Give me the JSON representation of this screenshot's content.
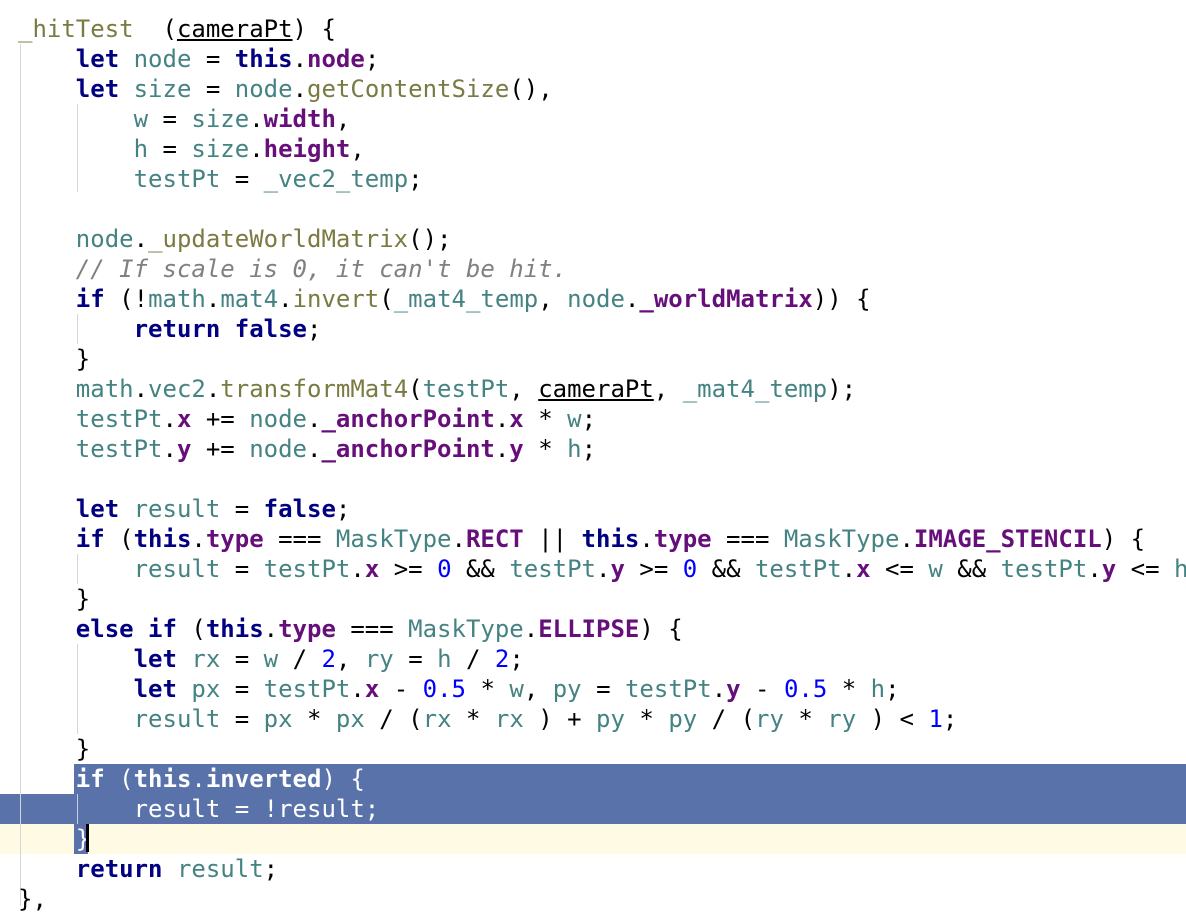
{
  "editor": {
    "selection_color": "#5a72aa",
    "current_line_color": "#fffae3",
    "lines": [
      [
        [
          "fn",
          "_hitTest"
        ],
        [
          "",
          "  ("
        ],
        [
          "param",
          "cameraPt"
        ],
        [
          "",
          ") {"
        ]
      ],
      [
        [
          "",
          "    "
        ],
        [
          "kw",
          "let"
        ],
        [
          "",
          "",
          " "
        ],
        [
          "id",
          "node"
        ],
        [
          "",
          " = "
        ],
        [
          "kw",
          "this"
        ],
        [
          "",
          "."
        ],
        [
          "prop",
          "node"
        ],
        [
          "",
          ";"
        ]
      ],
      [
        [
          "",
          "    "
        ],
        [
          "kw",
          "let"
        ],
        [
          "",
          "",
          " "
        ],
        [
          "id",
          "size"
        ],
        [
          "",
          " = "
        ],
        [
          "id",
          "node"
        ],
        [
          "",
          "."
        ],
        [
          "fn",
          "getContentSize"
        ],
        [
          "",
          "(),"
        ]
      ],
      [
        [
          "",
          "        "
        ],
        [
          "id",
          "w"
        ],
        [
          "",
          " = "
        ],
        [
          "id",
          "size"
        ],
        [
          "",
          "."
        ],
        [
          "prop",
          "width"
        ],
        [
          "",
          ","
        ]
      ],
      [
        [
          "",
          "        "
        ],
        [
          "id",
          "h"
        ],
        [
          "",
          " = "
        ],
        [
          "id",
          "size"
        ],
        [
          "",
          "."
        ],
        [
          "prop",
          "height"
        ],
        [
          "",
          ","
        ]
      ],
      [
        [
          "",
          "        "
        ],
        [
          "id",
          "testPt"
        ],
        [
          "",
          " = "
        ],
        [
          "id",
          "_vec2_temp"
        ],
        [
          "",
          ";"
        ]
      ],
      [
        [
          "",
          ""
        ]
      ],
      [
        [
          "",
          "    "
        ],
        [
          "id",
          "node"
        ],
        [
          "",
          "."
        ],
        [
          "fn",
          "_updateWorldMatrix"
        ],
        [
          "",
          "();"
        ]
      ],
      [
        [
          "",
          "    "
        ],
        [
          "cm",
          "// If scale is 0, it can't be hit."
        ]
      ],
      [
        [
          "",
          "    "
        ],
        [
          "kw",
          "if"
        ],
        [
          "",
          " (!"
        ],
        [
          "id",
          "math"
        ],
        [
          "",
          "."
        ],
        [
          "id",
          "mat4"
        ],
        [
          "",
          "."
        ],
        [
          "fn",
          "invert"
        ],
        [
          "",
          "("
        ],
        [
          "id",
          "_mat4_temp"
        ],
        [
          "",
          ", "
        ],
        [
          "id",
          "node"
        ],
        [
          "",
          "."
        ],
        [
          "prop",
          "_worldMatrix"
        ],
        [
          "",
          ")) {"
        ]
      ],
      [
        [
          "",
          "        "
        ],
        [
          "kw",
          "return false"
        ],
        [
          "",
          ";"
        ]
      ],
      [
        [
          "",
          "    }"
        ]
      ],
      [
        [
          "",
          "    "
        ],
        [
          "id",
          "math"
        ],
        [
          "",
          "."
        ],
        [
          "id",
          "vec2"
        ],
        [
          "",
          "."
        ],
        [
          "fn",
          "transformMat4"
        ],
        [
          "",
          "("
        ],
        [
          "id",
          "testPt"
        ],
        [
          "",
          ", "
        ],
        [
          "param",
          "cameraPt"
        ],
        [
          "",
          ", "
        ],
        [
          "id",
          "_mat4_temp"
        ],
        [
          "",
          ");"
        ]
      ],
      [
        [
          "",
          "    "
        ],
        [
          "id",
          "testPt"
        ],
        [
          "",
          "."
        ],
        [
          "prop",
          "x"
        ],
        [
          "",
          " += "
        ],
        [
          "id",
          "node"
        ],
        [
          "",
          "."
        ],
        [
          "prop",
          "_anchorPoint"
        ],
        [
          "",
          "."
        ],
        [
          "prop",
          "x"
        ],
        [
          "",
          " * "
        ],
        [
          "id",
          "w"
        ],
        [
          "",
          ";"
        ]
      ],
      [
        [
          "",
          "    "
        ],
        [
          "id",
          "testPt"
        ],
        [
          "",
          "."
        ],
        [
          "prop",
          "y"
        ],
        [
          "",
          " += "
        ],
        [
          "id",
          "node"
        ],
        [
          "",
          "."
        ],
        [
          "prop",
          "_anchorPoint"
        ],
        [
          "",
          "."
        ],
        [
          "prop",
          "y"
        ],
        [
          "",
          " * "
        ],
        [
          "id",
          "h"
        ],
        [
          "",
          ";"
        ]
      ],
      [
        [
          "",
          ""
        ]
      ],
      [
        [
          "",
          "    "
        ],
        [
          "kw",
          "let"
        ],
        [
          "",
          " "
        ],
        [
          "id",
          "result"
        ],
        [
          "",
          " = "
        ],
        [
          "kw",
          "false"
        ],
        [
          "",
          ";"
        ]
      ],
      [
        [
          "",
          "    "
        ],
        [
          "kw",
          "if"
        ],
        [
          "",
          " ("
        ],
        [
          "kw",
          "this"
        ],
        [
          "",
          "."
        ],
        [
          "prop",
          "type"
        ],
        [
          "",
          " === "
        ],
        [
          "id",
          "MaskType"
        ],
        [
          "",
          "."
        ],
        [
          "prop",
          "RECT"
        ],
        [
          "",
          " || "
        ],
        [
          "kw",
          "this"
        ],
        [
          "",
          "."
        ],
        [
          "prop",
          "type"
        ],
        [
          "",
          " === "
        ],
        [
          "id",
          "MaskType"
        ],
        [
          "",
          "."
        ],
        [
          "prop",
          "IMAGE_STENCIL"
        ],
        [
          "",
          ") {"
        ]
      ],
      [
        [
          "",
          "        "
        ],
        [
          "id",
          "result"
        ],
        [
          "",
          " = "
        ],
        [
          "id",
          "testPt"
        ],
        [
          "",
          "."
        ],
        [
          "prop",
          "x"
        ],
        [
          "",
          " >= "
        ],
        [
          "num",
          "0"
        ],
        [
          "",
          " && "
        ],
        [
          "id",
          "testPt"
        ],
        [
          "",
          "."
        ],
        [
          "prop",
          "y"
        ],
        [
          "",
          " >= "
        ],
        [
          "num",
          "0"
        ],
        [
          "",
          " && "
        ],
        [
          "id",
          "testPt"
        ],
        [
          "",
          "."
        ],
        [
          "prop",
          "x"
        ],
        [
          "",
          " <= "
        ],
        [
          "id",
          "w"
        ],
        [
          "",
          " && "
        ],
        [
          "id",
          "testPt"
        ],
        [
          "",
          "."
        ],
        [
          "prop",
          "y"
        ],
        [
          "",
          " <= "
        ],
        [
          "id",
          "h"
        ],
        [
          "",
          ";"
        ]
      ],
      [
        [
          "",
          "    }"
        ]
      ],
      [
        [
          "",
          "    "
        ],
        [
          "kw",
          "else if"
        ],
        [
          "",
          " ("
        ],
        [
          "kw",
          "this"
        ],
        [
          "",
          "."
        ],
        [
          "prop",
          "type"
        ],
        [
          "",
          " === "
        ],
        [
          "id",
          "MaskType"
        ],
        [
          "",
          "."
        ],
        [
          "prop",
          "ELLIPSE"
        ],
        [
          "",
          ") {"
        ]
      ],
      [
        [
          "",
          "        "
        ],
        [
          "kw",
          "let"
        ],
        [
          "",
          " "
        ],
        [
          "id",
          "rx"
        ],
        [
          "",
          " = "
        ],
        [
          "id",
          "w"
        ],
        [
          "",
          " / "
        ],
        [
          "num",
          "2"
        ],
        [
          "",
          ", "
        ],
        [
          "id",
          "ry"
        ],
        [
          "",
          " = "
        ],
        [
          "id",
          "h"
        ],
        [
          "",
          " / "
        ],
        [
          "num",
          "2"
        ],
        [
          "",
          ";"
        ]
      ],
      [
        [
          "",
          "        "
        ],
        [
          "kw",
          "let"
        ],
        [
          "",
          " "
        ],
        [
          "id",
          "px"
        ],
        [
          "",
          " = "
        ],
        [
          "id",
          "testPt"
        ],
        [
          "",
          "."
        ],
        [
          "prop",
          "x"
        ],
        [
          "",
          " - "
        ],
        [
          "num",
          "0.5"
        ],
        [
          "",
          " * "
        ],
        [
          "id",
          "w"
        ],
        [
          "",
          ", "
        ],
        [
          "id",
          "py"
        ],
        [
          "",
          " = "
        ],
        [
          "id",
          "testPt"
        ],
        [
          "",
          "."
        ],
        [
          "prop",
          "y"
        ],
        [
          "",
          " - "
        ],
        [
          "num",
          "0.5"
        ],
        [
          "",
          " * "
        ],
        [
          "id",
          "h"
        ],
        [
          "",
          ";"
        ]
      ],
      [
        [
          "",
          "        "
        ],
        [
          "id",
          "result"
        ],
        [
          "",
          " = "
        ],
        [
          "id",
          "px"
        ],
        [
          "",
          " * "
        ],
        [
          "id",
          "px"
        ],
        [
          "",
          " / ("
        ],
        [
          "id",
          "rx"
        ],
        [
          "",
          " * "
        ],
        [
          "id",
          "rx"
        ],
        [
          "",
          " ) + "
        ],
        [
          "id",
          "py"
        ],
        [
          "",
          " * "
        ],
        [
          "id",
          "py"
        ],
        [
          "",
          " / ("
        ],
        [
          "id",
          "ry"
        ],
        [
          "",
          " * "
        ],
        [
          "id",
          "ry"
        ],
        [
          "",
          " ) < "
        ],
        [
          "num",
          "1"
        ],
        [
          "",
          ";"
        ]
      ],
      [
        [
          "",
          "    }"
        ]
      ],
      [
        [
          "",
          "    "
        ],
        [
          "kw",
          "if"
        ],
        [
          "",
          " ("
        ],
        [
          "kw",
          "this"
        ],
        [
          "",
          "."
        ],
        [
          "prop",
          "inverted"
        ],
        [
          "",
          ") {"
        ]
      ],
      [
        [
          "",
          "        "
        ],
        [
          "id",
          "result"
        ],
        [
          "",
          " = !"
        ],
        [
          "id",
          "result"
        ],
        [
          "",
          ";"
        ]
      ],
      [
        [
          "",
          "    }"
        ]
      ],
      [
        [
          "",
          "    "
        ],
        [
          "kw",
          "return"
        ],
        [
          "",
          " "
        ],
        [
          "id",
          "result"
        ],
        [
          "",
          ";"
        ]
      ],
      [
        [
          "",
          "},"
        ]
      ]
    ]
  }
}
